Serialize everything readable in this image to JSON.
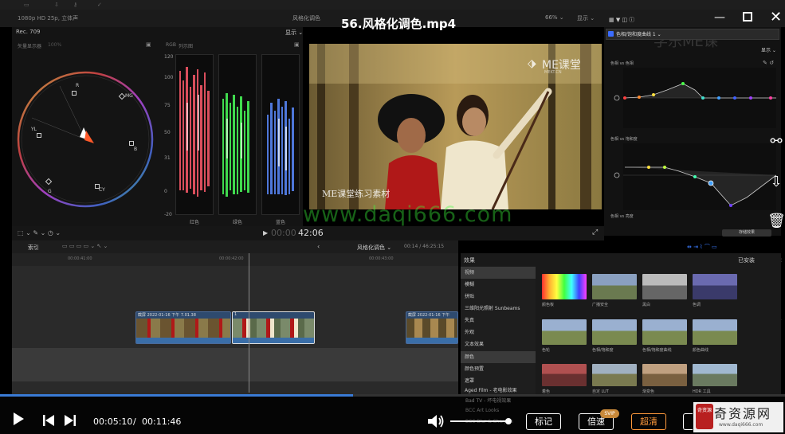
{
  "header": {
    "format": "1080p HD 25p, 立体声",
    "mode": "风格化调色",
    "title": "56.风格化调色.mp4",
    "zoom": "66% ⌄",
    "view": "显示 ⌄"
  },
  "scopes": {
    "label": "Rec. 709",
    "display": "显示 ⌄",
    "vectorscope_label": "矢量显示器",
    "vectorscope_pct": "100%",
    "rgb_label": "RGB",
    "rgb_title": "列示图",
    "targets": [
      "R",
      "MG",
      "B",
      "CY",
      "G",
      "YL"
    ],
    "axis": [
      "120",
      "100",
      "75",
      "50",
      "31",
      "0",
      "-20"
    ],
    "channels": [
      "红色",
      "绿色",
      "蓝色"
    ]
  },
  "video": {
    "brand": "ME课堂",
    "brand_sub": "MEKT.CN",
    "caption": "ME课堂练习素材",
    "watermark": "www.daqi666.com",
    "ghost": "学乐ME课"
  },
  "color_panel": {
    "title": "色相/饱和度曲线 1 ⌄",
    "display": "显示 ⌄",
    "curve1": "色相 vs 色相",
    "curve2": "色相 vs 饱和度",
    "curve3": "色相 vs 亮度",
    "save": "存储效果"
  },
  "toolbar": {
    "tools": "⬚ ⌄  ✎ ⌄  ◷ ⌄",
    "play": "▶",
    "tc_dim": "00:00",
    "tc": "42:06",
    "expand": "⤢"
  },
  "timeline": {
    "index": "索引",
    "back": "‹",
    "project": "风格化调色 ⌄",
    "duration": "00:14 / 46:25:15",
    "ruler": [
      "00:00:41:00",
      "00:00:42:00",
      "00:00:43:00"
    ],
    "clips": [
      {
        "label": "截屏 2022-01-16 下午 7.01.38"
      },
      {
        "label": "1"
      },
      {
        "label": "截屏 2022-01-16 下午"
      }
    ]
  },
  "effects": {
    "title": "效果",
    "installed": "已安装",
    "categories": [
      "视频",
      "模糊",
      "拼贴",
      "三维阳光照射 Sunbeams",
      "失真",
      "外观",
      "文本效果",
      "颜色",
      "颜色预置",
      "遮罩",
      "Aged Film - 老电影效果",
      "Bad TV - 坏电视效果",
      "BCC Art Looks",
      "BCC Blur & Sharpen"
    ],
    "items": [
      "颜色板",
      "广播安全",
      "黑白",
      "色调",
      "色轮",
      "色相/饱和度",
      "色相/饱和度曲线",
      "颜色曲线",
      "着色",
      "自定 LUT",
      "渐变色",
      "HDR 工具"
    ]
  },
  "player": {
    "progress": 0.45,
    "current": "00:05:10",
    "sep": "/",
    "total": "00:11:46",
    "tag_btn": "标记",
    "speed_btn": "倍速",
    "svip": "SVIP",
    "hd_btn": "超清",
    "logo": "奇资源网",
    "logo_url": "www.daqi666.com",
    "seal": "奇资源"
  }
}
